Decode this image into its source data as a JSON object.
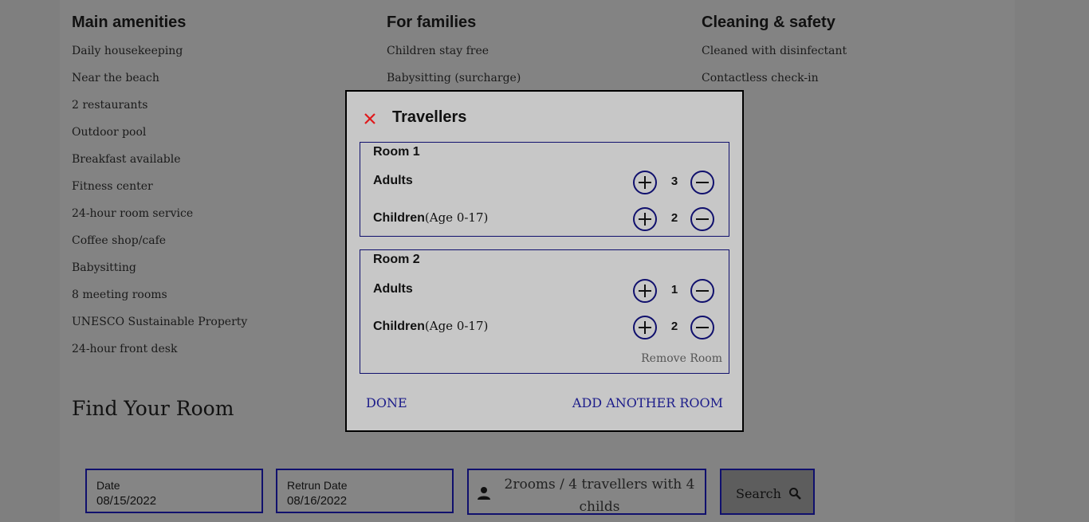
{
  "amenities": {
    "main": {
      "title": "Main amenities",
      "items": [
        "Daily housekeeping",
        "Near the beach",
        "2 restaurants",
        "Outdoor pool",
        "Breakfast available",
        "Fitness center",
        "24-hour room service",
        "Coffee shop/cafe",
        "Babysitting",
        "8 meeting rooms",
        "UNESCO Sustainable Property",
        "24-hour front desk"
      ]
    },
    "families": {
      "title": "For families",
      "items": [
        "Children stay free",
        "Babysitting (surcharge)"
      ]
    },
    "cleaning": {
      "title": "Cleaning & safety",
      "items": [
        "Cleaned with disinfectant",
        "Contactless check-in"
      ]
    }
  },
  "find_room": {
    "title": "Find Your Room",
    "date_label": "Date",
    "date_value": "08/15/2022",
    "return_label": "Retrun Date",
    "return_value": "08/16/2022",
    "travellers_summary": "2rooms / 4 travellers with 4 childs",
    "search_label": "Search",
    "icons": {
      "person": "person-icon",
      "search": "search-icon"
    }
  },
  "modal": {
    "title": "Travellers",
    "close_icon": "close-icon",
    "rooms": [
      {
        "title": "Room 1",
        "adults_label": "Adults",
        "adults": "3",
        "children_label": "Children",
        "children_age": "(Age 0-17)",
        "children": "2"
      },
      {
        "title": "Room 2",
        "adults_label": "Adults",
        "adults": "1",
        "children_label": "Children",
        "children_age": "(Age 0-17)",
        "children": "2",
        "remove_label": "Remove Room"
      }
    ],
    "done_label": "DONE",
    "add_room_label": "ADD ANOTHER ROOM"
  },
  "colors": {
    "accent": "#10106d",
    "close": "#e0191b",
    "link": "#1c1c8a"
  }
}
